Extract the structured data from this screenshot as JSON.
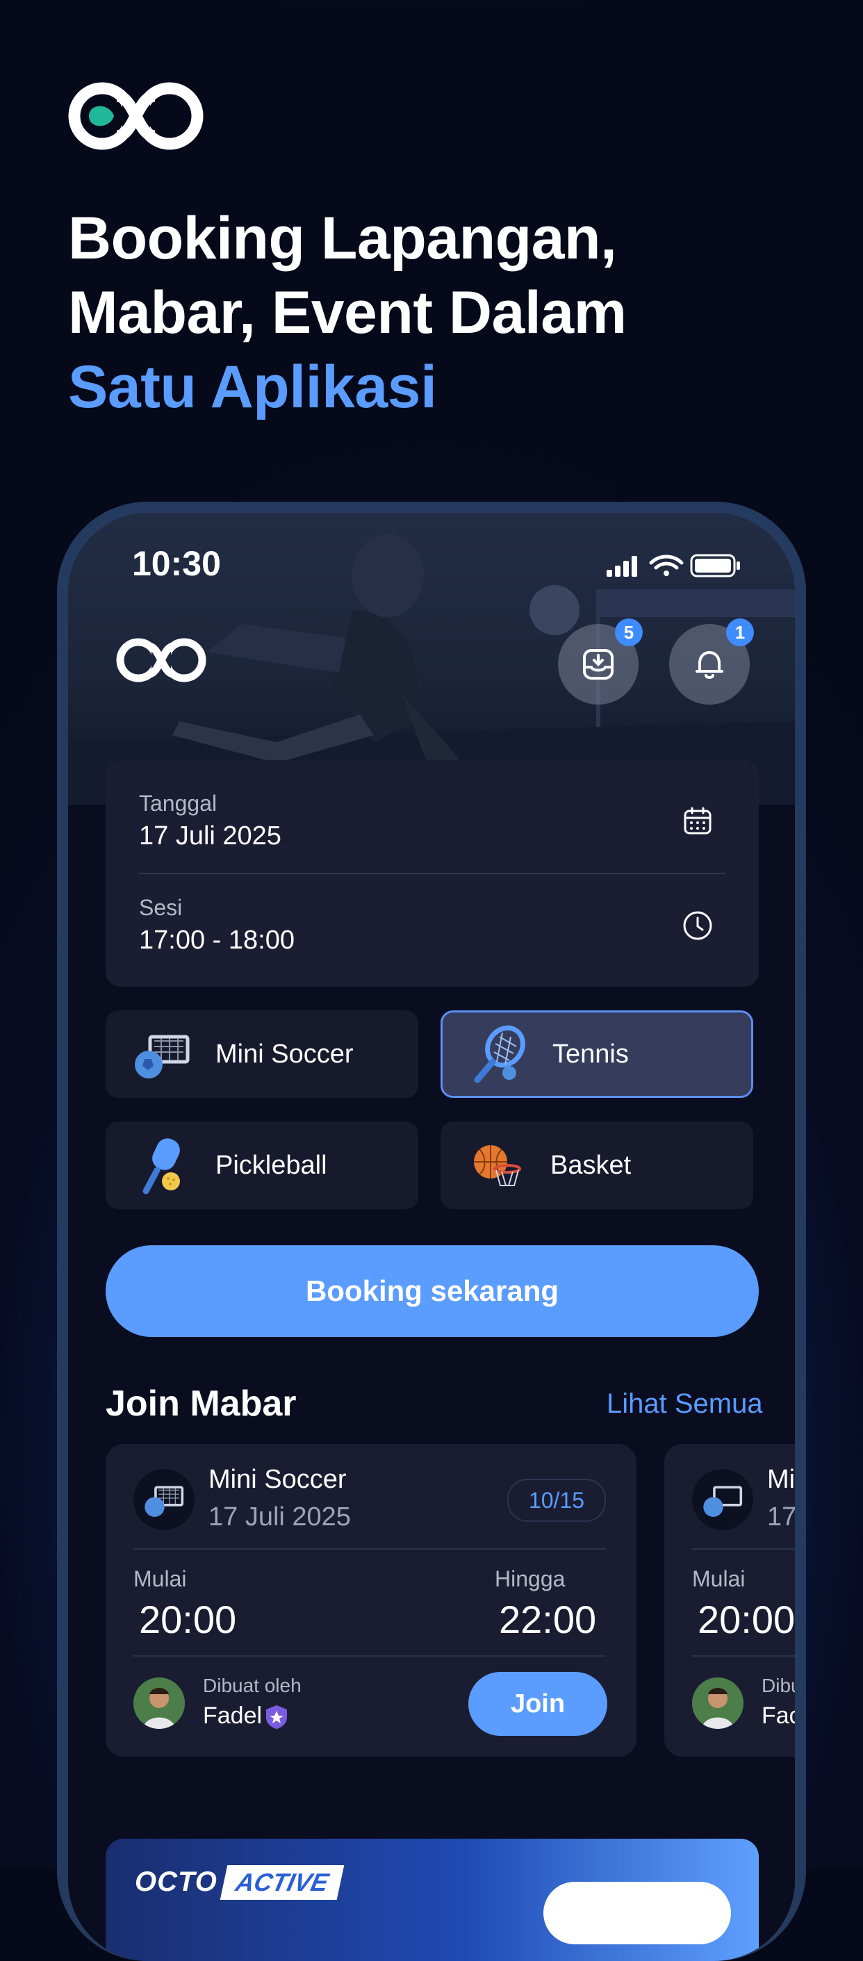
{
  "headline": {
    "line1": "Booking Lapangan,",
    "line2": "Mabar, Event Dalam",
    "line3": "Satu Aplikasi"
  },
  "status_bar": {
    "time": "10:30"
  },
  "header": {
    "inbox_badge": "5",
    "notification_badge": "1"
  },
  "booking_form": {
    "date_label": "Tanggal",
    "date_value": "17 Juli 2025",
    "session_label": "Sesi",
    "session_value": "17:00 - 18:00"
  },
  "sports": [
    {
      "label": "Mini Soccer",
      "selected": false
    },
    {
      "label": "Tennis",
      "selected": true
    },
    {
      "label": "Pickleball",
      "selected": false
    },
    {
      "label": "Basket",
      "selected": false
    }
  ],
  "cta_label": "Booking sekarang",
  "join_mabar": {
    "title": "Join Mabar",
    "see_all": "Lihat Semua",
    "cards": [
      {
        "sport": "Mini Soccer",
        "date": "17 Juli 2025",
        "slots": "10/15",
        "start_label": "Mulai",
        "start": "20:00",
        "end_label": "Hingga",
        "end": "22:00",
        "created_by_label": "Dibuat oleh",
        "created_by": "Fadel",
        "join_label": "Join"
      },
      {
        "sport": "Mi",
        "date": "17",
        "start_label": "Mulai",
        "start": "20:00",
        "created_by_label": "Dibu",
        "created_by": "Fac"
      }
    ]
  },
  "promo": {
    "brand_part1": "OCTO",
    "brand_part2": "ACTIVE"
  },
  "colors": {
    "accent": "#5a9cff",
    "card": "#1b1e33",
    "background": "#06091a",
    "badge": "#3f8cff"
  },
  "icons": [
    "calendar-icon",
    "clock-icon",
    "inbox-download-icon",
    "bell-icon",
    "wifi-icon",
    "battery-icon",
    "signal-icon",
    "verified-badge-icon"
  ]
}
